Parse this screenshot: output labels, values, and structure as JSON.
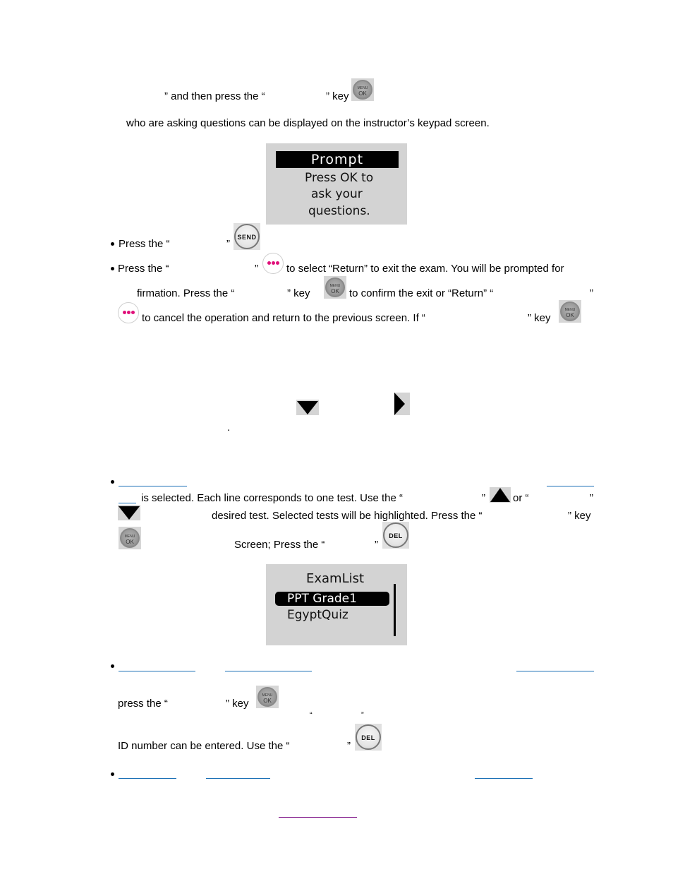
{
  "paragraphs": {
    "p1_line1_a": "” and then press the “",
    "p1_line1_b": "” key",
    "p1_line2": "who are asking questions can be displayed on the instructor’s keypad screen."
  },
  "prompt_screen": {
    "title": "Prompt",
    "lines": [
      "Press OK to",
      "ask your",
      "questions."
    ]
  },
  "bullets": {
    "send_line_a": "Press the “",
    "send_line_b": "”",
    "return_line_a": "Press the “",
    "return_line_b": "”",
    "return_line_c": "to select “Return” to exit the exam. You will be prompted for",
    "confirm_line_a": "firmation. Press the “",
    "confirm_line_b": "” key",
    "confirm_line_c": "to confirm the exit or “Return” “",
    "confirm_line_d": "”",
    "cancel_line_a": "to  cancel  the  operation  and  return  to  the  previous  screen.  If  “",
    "cancel_line_b": "”  key",
    "period": "."
  },
  "exam_section": {
    "selected_line_a": "is selected. Each line corresponds to one test. Use the “",
    "selected_line_b": "”",
    "selected_line_c": "or “",
    "selected_line_d": "”",
    "desired_line_a": "desired test. Selected tests will be highlighted. Press the “",
    "desired_line_b": "” key",
    "screen_line_a": "Screen; Press the “",
    "screen_line_b": "”"
  },
  "exam_screen": {
    "title": "ExamList",
    "items": [
      {
        "label": "PPT Grade1",
        "selected": true
      },
      {
        "label": "EgyptQuiz",
        "selected": false
      }
    ]
  },
  "id_section": {
    "press_line_a": "press  the  “",
    "press_line_b": "”  key",
    "quote_open": "“",
    "quote_close": "”",
    "id_line_a": "ID number can be entered. Use the “",
    "id_line_b": "”"
  },
  "keys": {
    "menu_ok_top": "MENU",
    "menu_ok_bottom": "OK",
    "send": "SEND",
    "del": "DEL"
  },
  "icons": {
    "menu_ok": "menu-ok-key-icon",
    "send": "send-key-icon",
    "dots": "more-dots-key-icon",
    "del": "del-key-icon",
    "up": "up-arrow-icon",
    "down": "down-arrow-icon",
    "right": "right-arrow-icon"
  },
  "colors": {
    "link": "#1a6fb5",
    "visited_link": "#7a0a84",
    "dots": "#e0107a",
    "screen_bg": "#d3d3d3"
  }
}
